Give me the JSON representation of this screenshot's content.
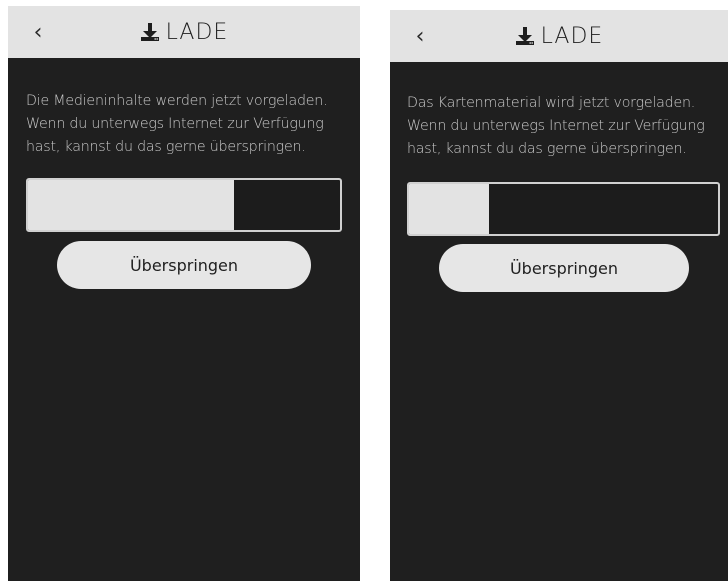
{
  "screens": [
    {
      "back_icon": "chevron-left-icon",
      "title_icon": "download-icon",
      "title": "LADE",
      "message_lines": [
        "Die Medieninhalte werden jetzt vorgeladen.",
        "Wenn du unterwegs Internet zur Verfügung",
        "hast, kannst du das gerne überspringen."
      ],
      "progress": 0.66,
      "skip_label": "Überspringen"
    },
    {
      "back_icon": "chevron-left-icon",
      "title_icon": "download-icon",
      "title": "LADE",
      "message_lines": [
        "Das Kartenmaterial wird jetzt vorgeladen.",
        "Wenn du unterwegs Internet zur Verfügung",
        "hast, kannst du das gerne überspringen."
      ],
      "progress": 0.26,
      "skip_label": "Überspringen"
    }
  ],
  "colors": {
    "background": "#1f1f1f",
    "appbar": "#e3e3e3",
    "text": "#c8c8c8",
    "button": "#e6e6e6",
    "progress_fill": "#e3e3e3"
  }
}
